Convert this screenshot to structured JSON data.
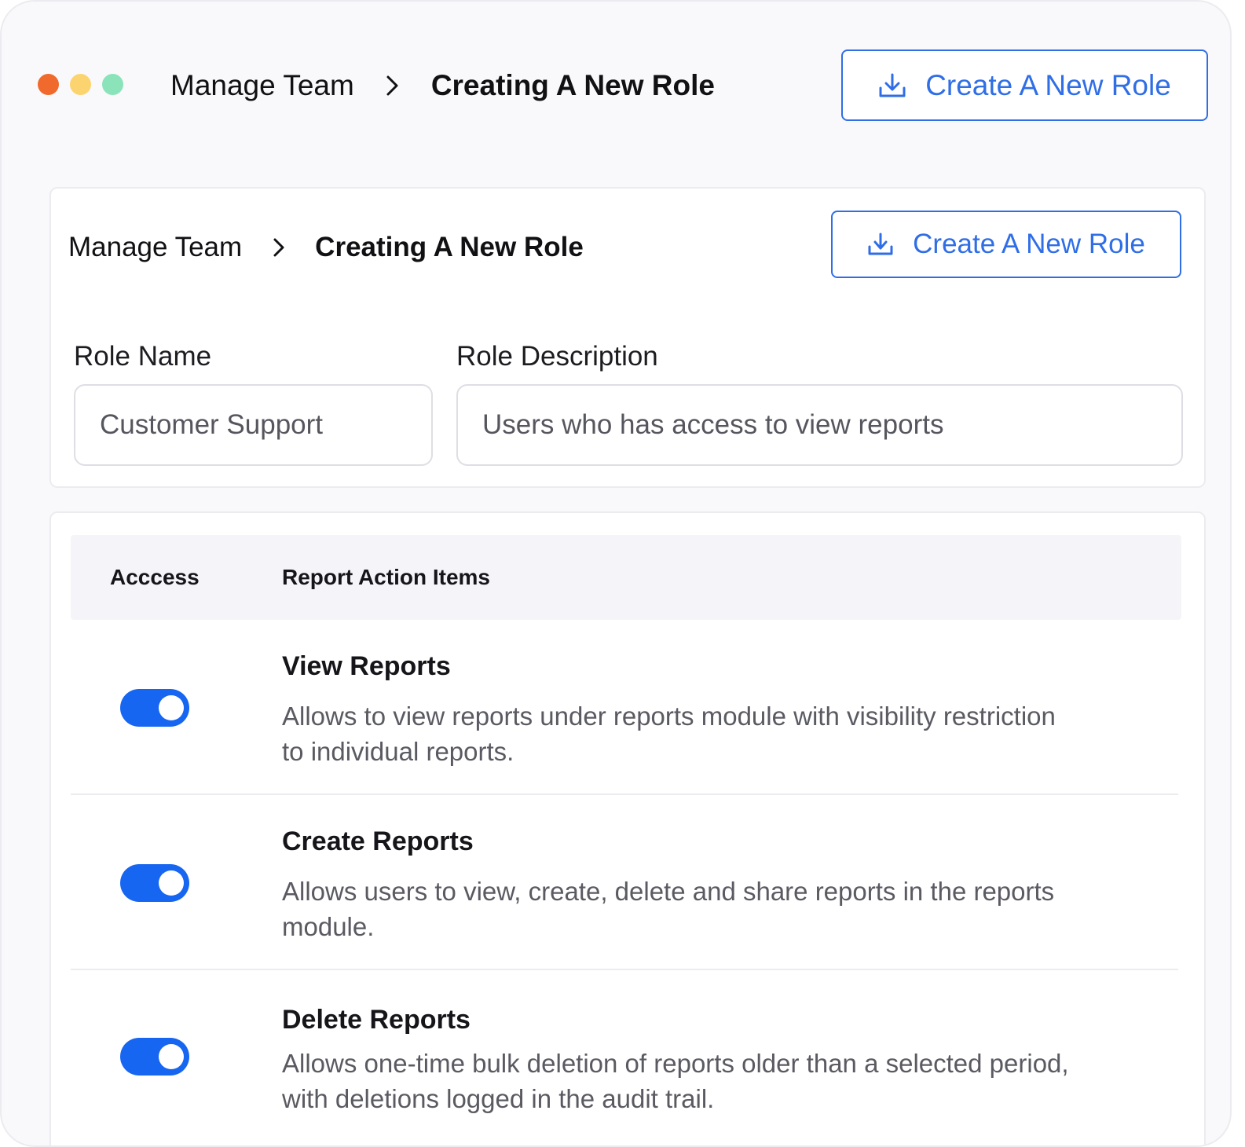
{
  "colors": {
    "accent": "#2f6ee6",
    "toggle_on": "#1766f1",
    "dot_red": "#ef6a2c",
    "dot_yellow": "#fcd46f",
    "dot_green": "#8be3b9"
  },
  "titlebar": {
    "breadcrumb_parent": "Manage Team",
    "breadcrumb_current": "Creating A New Role",
    "button_label": "Create A New Role",
    "button_icon": "download-icon"
  },
  "form_card": {
    "breadcrumb_parent": "Manage Team",
    "breadcrumb_current": "Creating A New Role",
    "button_label": "Create A New Role",
    "role_name": {
      "label": "Role Name",
      "value": "Customer Support"
    },
    "role_description": {
      "label": "Role Description",
      "value": "Users who has access to view reports"
    }
  },
  "permissions": {
    "columns": [
      "Acccess",
      "Report Action Items"
    ],
    "rows": [
      {
        "title": "View Reports",
        "description": "Allows to view reports under reports module with visibility restriction to individual reports.",
        "enabled": true
      },
      {
        "title": "Create Reports",
        "description": "Allows users to view, create, delete and share reports in the reports module.",
        "enabled": true
      },
      {
        "title": "Delete Reports",
        "description": "Allows one-time bulk deletion of reports older than a selected period, with deletions logged in the audit trail.",
        "enabled": true
      }
    ]
  }
}
